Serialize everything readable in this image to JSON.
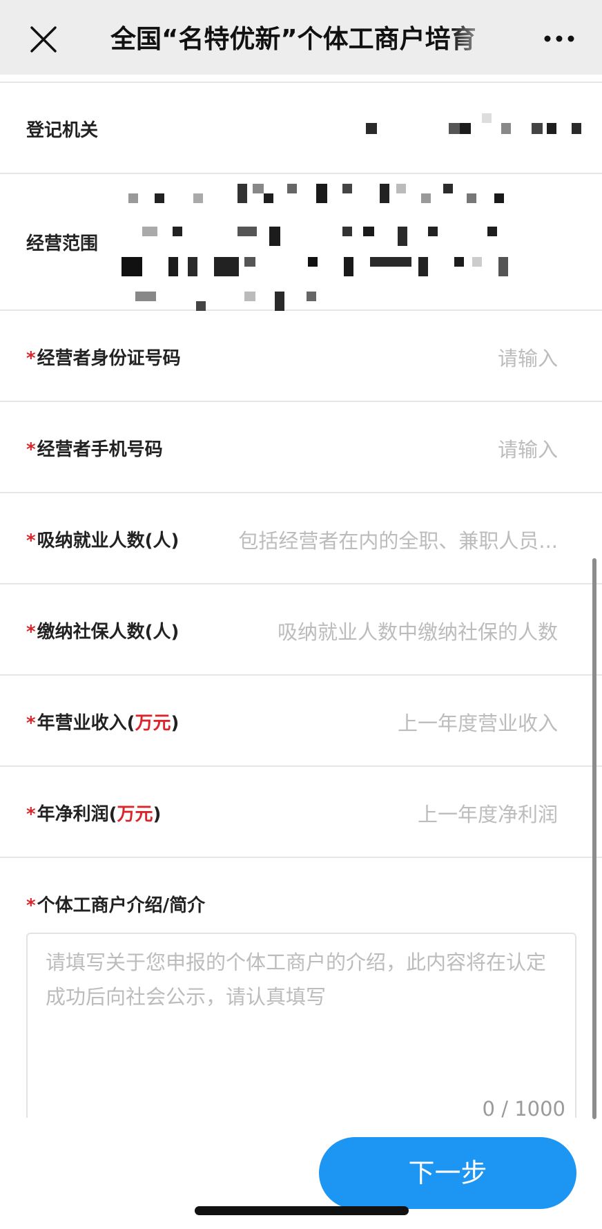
{
  "header": {
    "title": "全国“名特优新”个体工商户培育"
  },
  "fields": {
    "registration_authority": {
      "label": "登记机关"
    },
    "business_scope": {
      "label": "经营范围"
    },
    "id_number": {
      "label": "经营者身份证号码",
      "placeholder": "请输入"
    },
    "phone": {
      "label": "经营者手机号码",
      "placeholder": "请输入"
    },
    "employees": {
      "label_main": "吸纳就业人数",
      "label_unit": "(人)",
      "placeholder": "包括经营者在内的全职、兼职人员..."
    },
    "social_insured": {
      "label_main": "缴纳社保人数",
      "label_unit": "(人)",
      "placeholder": "吸纳就业人数中缴纳社保的人数"
    },
    "annual_revenue": {
      "label_main": "年营业收入(",
      "label_unit": "万元",
      "label_close": ")",
      "placeholder": "上一年度营业收入"
    },
    "net_profit": {
      "label_main": "年净利润(",
      "label_unit": "万元",
      "label_close": ")",
      "placeholder": "上一年度净利润"
    }
  },
  "intro": {
    "label": "个体工商户介绍/简介",
    "placeholder": "请填写关于您申报的个体工商户的介绍，此内容将在认定成功后向社会公示，请认真填写",
    "counter": "0 / 1000"
  },
  "required_mark": "*",
  "next_button": {
    "label": "下一步"
  },
  "colors": {
    "accent": "#1c95f3",
    "required": "#d9262b",
    "placeholder": "#bcbcbc"
  },
  "icons": {
    "close": "close-icon",
    "more": "more-icon"
  }
}
